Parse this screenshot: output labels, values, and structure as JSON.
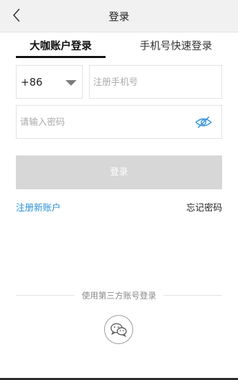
{
  "header": {
    "title": "登录",
    "back_icon": "chevron-left-icon"
  },
  "tabs": {
    "password_login": "大咖账户登录",
    "sms_login": "手机号快速登录",
    "active": "password_login"
  },
  "form": {
    "country_code": "+86",
    "phone_placeholder": "注册手机号",
    "phone_value": "",
    "password_placeholder": "请输入密码",
    "password_value": "",
    "eye_icon": "eye-slash-icon",
    "login_button": "登录"
  },
  "links": {
    "register": "注册新账户",
    "forgot_password": "忘记密码"
  },
  "third_party": {
    "label": "使用第三方账号登录",
    "wechat_icon": "wechat-icon"
  },
  "colors": {
    "link_blue": "#2a8fd8",
    "button_disabled": "#d7d7d7",
    "header_bg": "#f1f1f1"
  }
}
